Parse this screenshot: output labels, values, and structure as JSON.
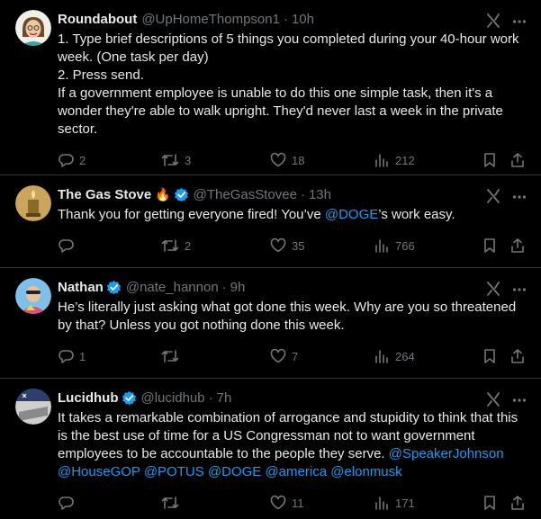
{
  "tweets": [
    {
      "name": "Roundabout",
      "emoji": "",
      "verified": false,
      "handle": "@UpHomeThompson1",
      "time": "10h",
      "text": "1. Type brief descriptions of 5 things you completed during your 40-hour work week. (One task per day)\n2. Press send.\nIf a government employee is unable to do this one simple task, then it's a wonder they're able to walk upright. They'd never last a week in the private sector.",
      "replies": "2",
      "retweets": "3",
      "likes": "18",
      "views": "212"
    },
    {
      "name": "The Gas Stove",
      "emoji": "🔥",
      "verified": true,
      "handle": "@TheGasStovee",
      "time": "13h",
      "text_before": "Thank you for getting everyone fired! You’ve ",
      "mention": "@DOGE",
      "text_after": "’s work easy.",
      "replies": "",
      "retweets": "2",
      "likes": "35",
      "views": "766"
    },
    {
      "name": "Nathan",
      "emoji": "",
      "verified": true,
      "handle": "@nate_hannon",
      "time": "9h",
      "text": "He’s literally just asking what got done this week. Why are you so threatened by that? Unless you got nothing done this week.",
      "replies": "1",
      "retweets": "",
      "likes": "7",
      "views": "264"
    },
    {
      "name": "Lucidhub",
      "emoji": "",
      "verified": true,
      "handle": "@lucidhub",
      "time": "7h",
      "text": "It takes a remarkable combination of arrogance and stupidity to think that this is the best use of time for a US Congressman not to want government employees to be accountable to the people they serve. ",
      "mentions_line1": "@SpeakerJohnson",
      "mentions_line2": "@HouseGOP @POTUS @DOGE @america @elonmusk",
      "replies": "",
      "retweets": "",
      "likes": "11",
      "views": "171"
    }
  ],
  "separator": "·",
  "colors": {
    "background": "#000000",
    "text": "#e7e9ea",
    "muted": "#71767b",
    "accent": "#1d9bf0",
    "border": "#2f3336"
  },
  "icons": [
    "reply-icon",
    "retweet-icon",
    "like-icon",
    "views-icon",
    "bookmark-icon",
    "share-icon",
    "grok-icon",
    "more-icon",
    "verified-badge-icon"
  ]
}
